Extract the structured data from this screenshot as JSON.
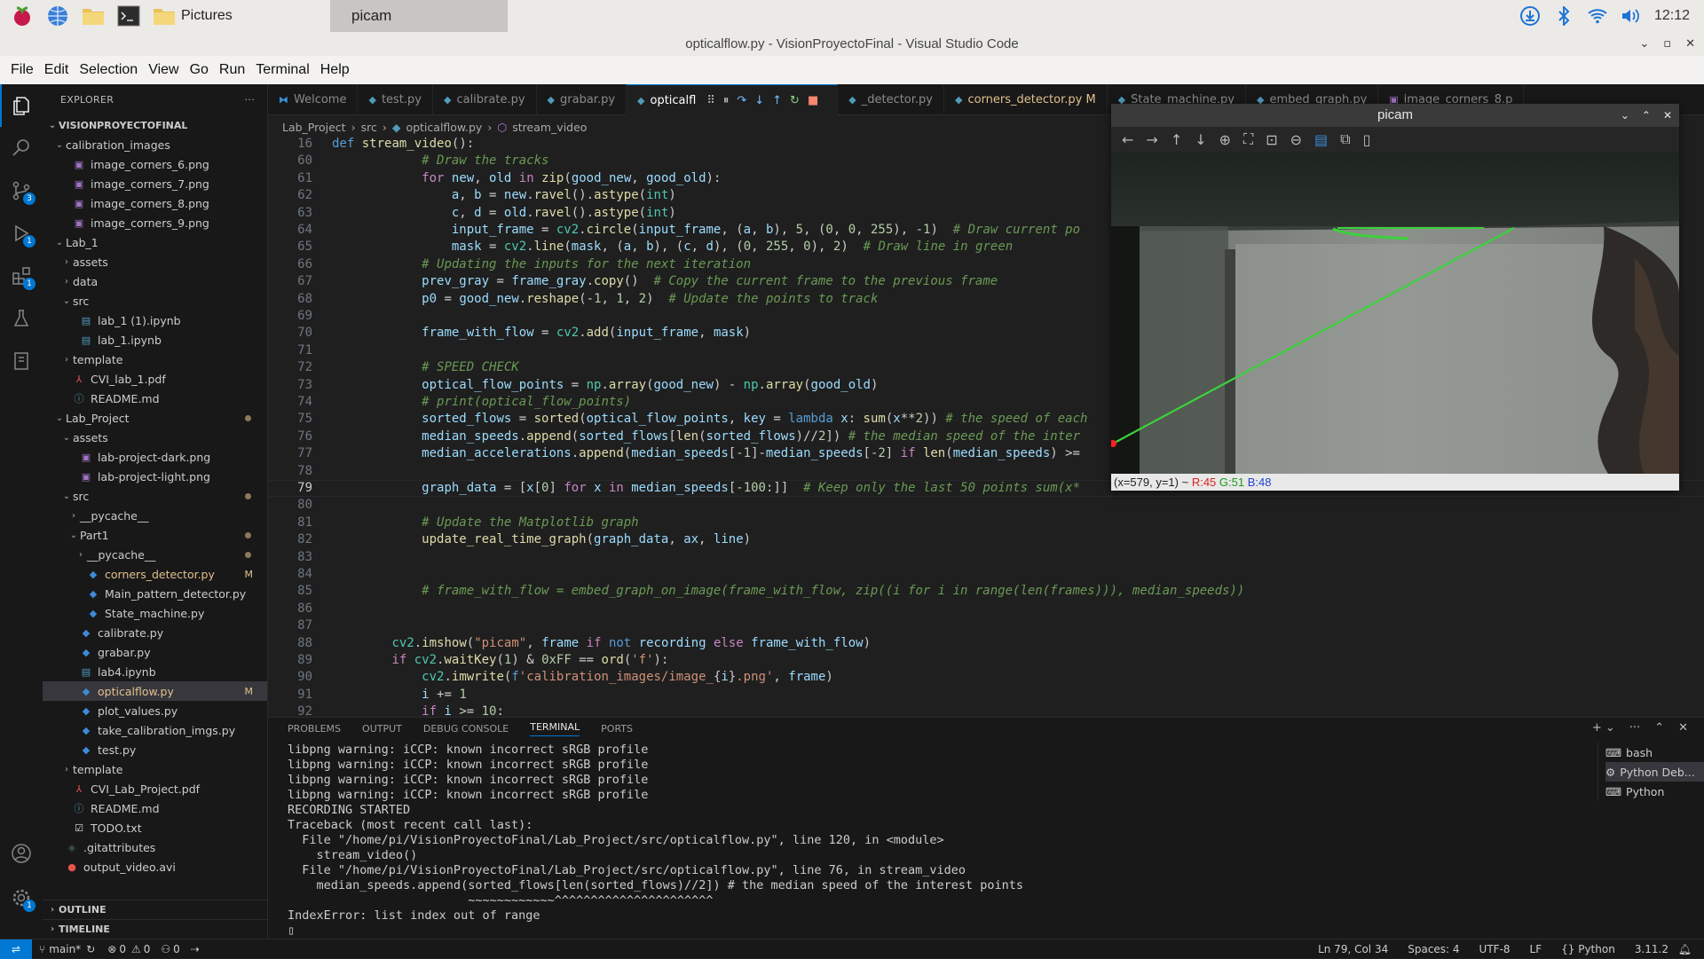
{
  "taskbar": {
    "pictures_label": "Pictures",
    "picam_label": "picam",
    "clock": "12:12"
  },
  "window_title": "opticalflow.py - VisionProyectoFinal - Visual Studio Code",
  "menu": [
    "File",
    "Edit",
    "Selection",
    "View",
    "Go",
    "Run",
    "Terminal",
    "Help"
  ],
  "explorer": {
    "header": "EXPLORER",
    "root": "VISIONPROYECTOFINAL",
    "rows": [
      {
        "indent": 1,
        "chev": "v",
        "label": "calibration_images",
        "icon": "folder"
      },
      {
        "indent": 2,
        "label": "image_corners_6.png",
        "icon": "image"
      },
      {
        "indent": 2,
        "label": "image_corners_7.png",
        "icon": "image"
      },
      {
        "indent": 2,
        "label": "image_corners_8.png",
        "icon": "image"
      },
      {
        "indent": 2,
        "label": "image_corners_9.png",
        "icon": "image"
      },
      {
        "indent": 1,
        "chev": "v",
        "label": "Lab_1",
        "icon": "folder"
      },
      {
        "indent": 2,
        "chev": ">",
        "label": "assets",
        "icon": "folder"
      },
      {
        "indent": 2,
        "chev": ">",
        "label": "data",
        "icon": "folder"
      },
      {
        "indent": 2,
        "chev": "v",
        "label": "src",
        "icon": "folder"
      },
      {
        "indent": 3,
        "label": "lab_1 (1).ipynb",
        "icon": "notebook"
      },
      {
        "indent": 3,
        "label": "lab_1.ipynb",
        "icon": "notebook"
      },
      {
        "indent": 2,
        "chev": ">",
        "label": "template",
        "icon": "folder"
      },
      {
        "indent": 2,
        "label": "CVI_lab_1.pdf",
        "icon": "pdf"
      },
      {
        "indent": 2,
        "label": "README.md",
        "icon": "info"
      },
      {
        "indent": 1,
        "chev": "v",
        "label": "Lab_Project",
        "icon": "folder",
        "dot": true
      },
      {
        "indent": 2,
        "chev": "v",
        "label": "assets",
        "icon": "folder"
      },
      {
        "indent": 3,
        "label": "lab-project-dark.png",
        "icon": "image"
      },
      {
        "indent": 3,
        "label": "lab-project-light.png",
        "icon": "image"
      },
      {
        "indent": 2,
        "chev": "v",
        "label": "src",
        "icon": "folder",
        "dot": true
      },
      {
        "indent": 3,
        "chev": ">",
        "label": "__pycache__",
        "icon": "folder"
      },
      {
        "indent": 3,
        "chev": "v",
        "label": "Part1",
        "icon": "folder",
        "dot": true
      },
      {
        "indent": 4,
        "chev": ">",
        "label": "__pycache__",
        "icon": "folder",
        "dot": true
      },
      {
        "indent": 4,
        "label": "corners_detector.py",
        "icon": "python",
        "mod": "M",
        "modified": true
      },
      {
        "indent": 4,
        "label": "Main_pattern_detector.py",
        "icon": "python"
      },
      {
        "indent": 4,
        "label": "State_machine.py",
        "icon": "python"
      },
      {
        "indent": 3,
        "label": "calibrate.py",
        "icon": "python"
      },
      {
        "indent": 3,
        "label": "grabar.py",
        "icon": "python"
      },
      {
        "indent": 3,
        "label": "lab4.ipynb",
        "icon": "notebook"
      },
      {
        "indent": 3,
        "label": "opticalflow.py",
        "icon": "python",
        "mod": "M",
        "selected": true,
        "modified": true
      },
      {
        "indent": 3,
        "label": "plot_values.py",
        "icon": "python"
      },
      {
        "indent": 3,
        "label": "take_calibration_imgs.py",
        "icon": "python"
      },
      {
        "indent": 3,
        "label": "test.py",
        "icon": "python"
      },
      {
        "indent": 2,
        "chev": ">",
        "label": "template",
        "icon": "folder"
      },
      {
        "indent": 2,
        "label": "CVI_Lab_Project.pdf",
        "icon": "pdf"
      },
      {
        "indent": 2,
        "label": "README.md",
        "icon": "info"
      },
      {
        "indent": 2,
        "label": "TODO.txt",
        "icon": "todo"
      },
      {
        "indent": 1,
        "label": ".gitattributes",
        "icon": "git"
      },
      {
        "indent": 1,
        "label": "output_video.avi",
        "icon": "video"
      }
    ],
    "outline": "OUTLINE",
    "timeline": "TIMELINE"
  },
  "tabs": [
    {
      "label": "Welcome",
      "icon": "vscode"
    },
    {
      "label": "test.py",
      "icon": "python"
    },
    {
      "label": "calibrate.py",
      "icon": "python"
    },
    {
      "label": "grabar.py",
      "icon": "python"
    },
    {
      "label": "opticalfl",
      "icon": "python",
      "active": true
    },
    {
      "label": "_detector.py",
      "icon": "python"
    },
    {
      "label": "corners_detector.py M",
      "icon": "python",
      "modified": true
    },
    {
      "label": "State_machine.py",
      "icon": "python"
    },
    {
      "label": "embed_graph.py",
      "icon": "python"
    },
    {
      "label": "image_corners_8.p",
      "icon": "image"
    }
  ],
  "breadcrumb": [
    "Lab_Project",
    "src",
    "opticalflow.py",
    "stream_video"
  ],
  "code": {
    "current_line": 79,
    "lines": [
      {
        "n": 16,
        "html": "<span class='bl'>def</span> <span class='fn'>stream_video</span>():"
      },
      {
        "n": 60,
        "html": "            <span class='cm'># Draw the tracks</span>"
      },
      {
        "n": 61,
        "html": "            <span class='kw'>for</span> <span class='va'>new</span>, <span class='va'>old</span> <span class='kw'>in</span> <span class='fn'>zip</span>(<span class='va'>good_new</span>, <span class='va'>good_old</span>):"
      },
      {
        "n": 62,
        "html": "                <span class='va'>a</span>, <span class='va'>b</span> = <span class='va'>new</span>.<span class='fn'>ravel</span>().<span class='fn'>astype</span>(<span class='ty'>int</span>)"
      },
      {
        "n": 63,
        "html": "                <span class='va'>c</span>, <span class='va'>d</span> = <span class='va'>old</span>.<span class='fn'>ravel</span>().<span class='fn'>astype</span>(<span class='ty'>int</span>)"
      },
      {
        "n": 64,
        "html": "                <span class='va'>input_frame</span> = <span class='ty'>cv2</span>.<span class='fn'>circle</span>(<span class='va'>input_frame</span>, (<span class='va'>a</span>, <span class='va'>b</span>), <span class='nu'>5</span>, (<span class='nu'>0</span>, <span class='nu'>0</span>, <span class='nu'>255</span>), <span class='nu'>-1</span>)  <span class='cm'># Draw current po</span>"
      },
      {
        "n": 65,
        "html": "                <span class='va'>mask</span> = <span class='ty'>cv2</span>.<span class='fn'>line</span>(<span class='va'>mask</span>, (<span class='va'>a</span>, <span class='va'>b</span>), (<span class='va'>c</span>, <span class='va'>d</span>), (<span class='nu'>0</span>, <span class='nu'>255</span>, <span class='nu'>0</span>), <span class='nu'>2</span>)  <span class='cm'># Draw line in green</span>"
      },
      {
        "n": 66,
        "html": "            <span class='cm'># Updating the inputs for the next iteration</span>"
      },
      {
        "n": 67,
        "html": "            <span class='va'>prev_gray</span> = <span class='va'>frame_gray</span>.<span class='fn'>copy</span>()  <span class='cm'># Copy the current frame to the previous frame</span>"
      },
      {
        "n": 68,
        "html": "            <span class='va'>p0</span> = <span class='va'>good_new</span>.<span class='fn'>reshape</span>(<span class='nu'>-1</span>, <span class='nu'>1</span>, <span class='nu'>2</span>)  <span class='cm'># Update the points to track</span>"
      },
      {
        "n": 69,
        "html": ""
      },
      {
        "n": 70,
        "html": "            <span class='va'>frame_with_flow</span> = <span class='ty'>cv2</span>.<span class='fn'>add</span>(<span class='va'>input_frame</span>, <span class='va'>mask</span>)"
      },
      {
        "n": 71,
        "html": ""
      },
      {
        "n": 72,
        "html": "            <span class='cm'># SPEED CHECK</span>"
      },
      {
        "n": 73,
        "html": "            <span class='va'>optical_flow_points</span> = <span class='ty'>np</span>.<span class='fn'>array</span>(<span class='va'>good_new</span>) - <span class='ty'>np</span>.<span class='fn'>array</span>(<span class='va'>good_old</span>)"
      },
      {
        "n": 74,
        "html": "            <span class='cm'># print(optical_flow_points)</span>"
      },
      {
        "n": 75,
        "html": "            <span class='va'>sorted_flows</span> = <span class='fn'>sorted</span>(<span class='va'>optical_flow_points</span>, <span class='va'>key</span> = <span class='bl'>lambda</span> <span class='va'>x</span>: <span class='fn'>sum</span>(<span class='va'>x</span>**<span class='nu'>2</span>)) <span class='cm'># the speed of each</span>"
      },
      {
        "n": 76,
        "html": "            <span class='va'>median_speeds</span>.<span class='fn'>append</span>(<span class='va'>sorted_flows</span>[<span class='fn'>len</span>(<span class='va'>sorted_flows</span>)//<span class='nu'>2</span>]) <span class='cm'># the median speed of the inter</span>"
      },
      {
        "n": 77,
        "html": "            <span class='va'>median_accelerations</span>.<span class='fn'>append</span>(<span class='va'>median_speeds</span>[<span class='nu'>-1</span>]-<span class='va'>median_speeds</span>[<span class='nu'>-2</span>] <span class='kw'>if</span> <span class='fn'>len</span>(<span class='va'>median_speeds</span>) >="
      },
      {
        "n": 78,
        "html": ""
      },
      {
        "n": 79,
        "html": "            <span class='va'>graph_data</span> = [<span class='va'>x</span>[<span class='nu'>0</span>] <span class='kw'>for</span> <span class='va'>x</span> <span class='kw'>in</span> <span class='va'>median_speeds</span>[<span class='nu'>-100</span>:]]  <span class='cm'># Keep only the last 50 points sum(x*</span>"
      },
      {
        "n": 80,
        "html": ""
      },
      {
        "n": 81,
        "html": "            <span class='cm'># Update the Matplotlib graph</span>"
      },
      {
        "n": 82,
        "html": "            <span class='fn'>update_real_time_graph</span>(<span class='va'>graph_data</span>, <span class='va'>ax</span>, <span class='va'>line</span>)"
      },
      {
        "n": 83,
        "html": ""
      },
      {
        "n": 84,
        "html": ""
      },
      {
        "n": 85,
        "html": "            <span class='cm'># frame_with_flow = embed_graph_on_image(frame_with_flow, zip((i for i in range(len(frames))), median_speeds))</span>"
      },
      {
        "n": 86,
        "html": ""
      },
      {
        "n": 87,
        "html": ""
      },
      {
        "n": 88,
        "html": "        <span class='ty'>cv2</span>.<span class='fn'>imshow</span>(<span class='st'>\"picam\"</span>, <span class='va'>frame</span> <span class='kw'>if</span> <span class='bl'>not</span> <span class='va'>recording</span> <span class='kw'>else</span> <span class='va'>frame_with_flow</span>)"
      },
      {
        "n": 89,
        "html": "        <span class='kw'>if</span> <span class='ty'>cv2</span>.<span class='fn'>waitKey</span>(<span class='nu'>1</span>) &amp; <span class='nu'>0xFF</span> == <span class='fn'>ord</span>(<span class='st'>'f'</span>):"
      },
      {
        "n": 90,
        "html": "            <span class='ty'>cv2</span>.<span class='fn'>imwrite</span>(<span class='bl'>f</span><span class='st'>'calibration_images/image_</span>{<span class='va'>i</span>}<span class='st'>.png'</span>, <span class='va'>frame</span>)"
      },
      {
        "n": 91,
        "html": "            <span class='va'>i</span> += <span class='nu'>1</span>"
      },
      {
        "n": 92,
        "html": "            <span class='kw'>if</span> <span class='va'>i</span> >= <span class='nu'>10</span>:"
      }
    ]
  },
  "panel": {
    "tabs": [
      "PROBLEMS",
      "OUTPUT",
      "DEBUG CONSOLE",
      "TERMINAL",
      "PORTS"
    ],
    "active_tab": "TERMINAL",
    "terminal_text": "libpng warning: iCCP: known incorrect sRGB profile\nlibpng warning: iCCP: known incorrect sRGB profile\nlibpng warning: iCCP: known incorrect sRGB profile\nlibpng warning: iCCP: known incorrect sRGB profile\nRECORDING STARTED\nTraceback (most recent call last):\n  File \"/home/pi/VisionProyectoFinal/Lab_Project/src/opticalflow.py\", line 120, in <module>\n    stream_video()\n  File \"/home/pi/VisionProyectoFinal/Lab_Project/src/opticalflow.py\", line 76, in stream_video\n    median_speeds.append(sorted_flows[len(sorted_flows)//2]) # the median speed of the interest points\n                         ~~~~~~~~~~~~^^^^^^^^^^^^^^^^^^^^^^\nIndexError: list index out of range\n▯",
    "terminals": [
      "bash",
      "Python Deb...",
      "Python"
    ]
  },
  "statusbar": {
    "branch": "main*",
    "errors": "0",
    "warnings": "0",
    "ports": "0",
    "position": "Ln 79, Col 34",
    "spaces": "Spaces: 4",
    "encoding": "UTF-8",
    "eol": "LF",
    "language": "Python",
    "version": "3.11.2"
  },
  "picam": {
    "title": "picam",
    "status_prefix": "(x=579, y=1) ~ ",
    "r": "R:45",
    "g": "G:51",
    "b": "B:48"
  }
}
